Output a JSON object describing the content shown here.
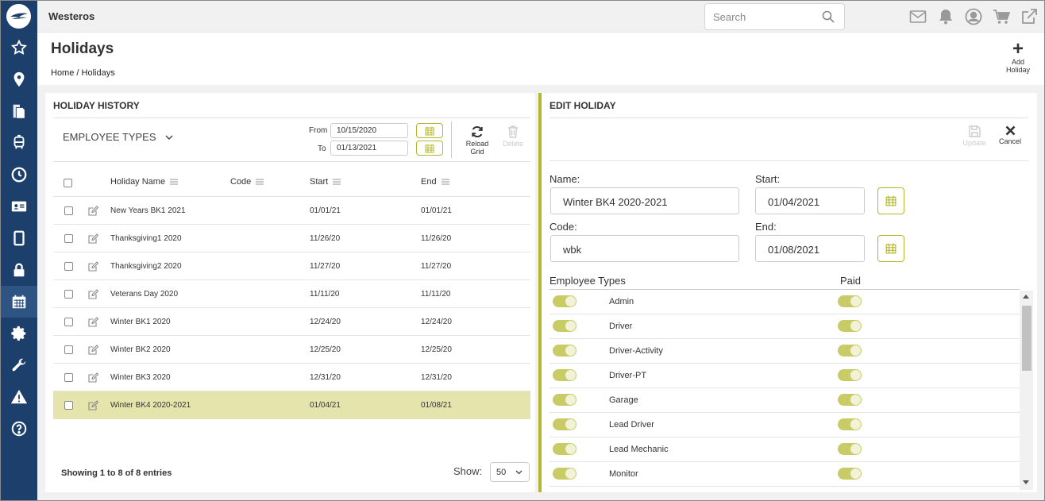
{
  "app": {
    "brand": "Westeros"
  },
  "search": {
    "placeholder": "Search"
  },
  "sidebar": {
    "icons": [
      "logo-icon",
      "star-icon",
      "map-pin-icon",
      "documents-icon",
      "bus-icon",
      "clock-icon",
      "id-card-icon",
      "tablet-icon",
      "lock-icon",
      "calendar-icon",
      "gear-icon",
      "wrench-icon",
      "warning-icon",
      "help-icon"
    ],
    "active": "calendar-icon"
  },
  "topbar_icons": [
    "mail-icon",
    "bell-icon",
    "user-icon",
    "cart-icon",
    "external-link-icon"
  ],
  "header": {
    "title": "Holidays",
    "breadcrumb": "Home / Holidays",
    "add_label_1": "Add",
    "add_label_2": "Holiday"
  },
  "history": {
    "title": "HOLIDAY HISTORY",
    "employee_types": "EMPLOYEE TYPES",
    "from_label": "From",
    "to_label": "To",
    "from_value": "10/15/2020",
    "to_value": "01/13/2021",
    "reload_1": "Reload",
    "reload_2": "Grid",
    "delete": "Delete",
    "columns": {
      "name": "Holiday Name",
      "code": "Code",
      "start": "Start",
      "end": "End"
    },
    "rows": [
      {
        "name": "New Years BK1 2021",
        "code": "",
        "start": "01/01/21",
        "end": "01/01/21"
      },
      {
        "name": "Thanksgiving1 2020",
        "code": "",
        "start": "11/26/20",
        "end": "11/26/20"
      },
      {
        "name": "Thanksgiving2 2020",
        "code": "",
        "start": "11/27/20",
        "end": "11/27/20"
      },
      {
        "name": "Veterans Day 2020",
        "code": "",
        "start": "11/11/20",
        "end": "11/11/20"
      },
      {
        "name": "Winter BK1 2020",
        "code": "",
        "start": "12/24/20",
        "end": "12/24/20"
      },
      {
        "name": "Winter BK2 2020",
        "code": "",
        "start": "12/25/20",
        "end": "12/25/20"
      },
      {
        "name": "Winter BK3 2020",
        "code": "",
        "start": "12/31/20",
        "end": "12/31/20"
      },
      {
        "name": "Winter BK4 2020-2021",
        "code": "",
        "start": "01/04/21",
        "end": "01/08/21"
      }
    ],
    "footer": "Showing 1 to 8 of 8 entries",
    "show_label": "Show:",
    "show_value": "50"
  },
  "edit": {
    "title": "EDIT HOLIDAY",
    "update": "Update",
    "cancel": "Cancel",
    "name_label": "Name:",
    "name_value": "Winter BK4  2020-2021",
    "start_label": "Start:",
    "start_value": "01/04/2021",
    "code_label": "Code:",
    "code_value": "wbk",
    "end_label": "End:",
    "end_value": "01/08/2021",
    "emp_types_label": "Employee Types",
    "paid_label": "Paid",
    "employee_types": [
      "Admin",
      "Driver",
      "Driver-Activity",
      "Driver-PT",
      "Garage",
      "Lead Driver",
      "Lead Mechanic",
      "Monitor"
    ]
  },
  "colors": {
    "sidebar": "#1c3f6b",
    "accent": "#b5b82a",
    "selected_row": "#e5e4ad",
    "toggle": "#c9cb66"
  }
}
